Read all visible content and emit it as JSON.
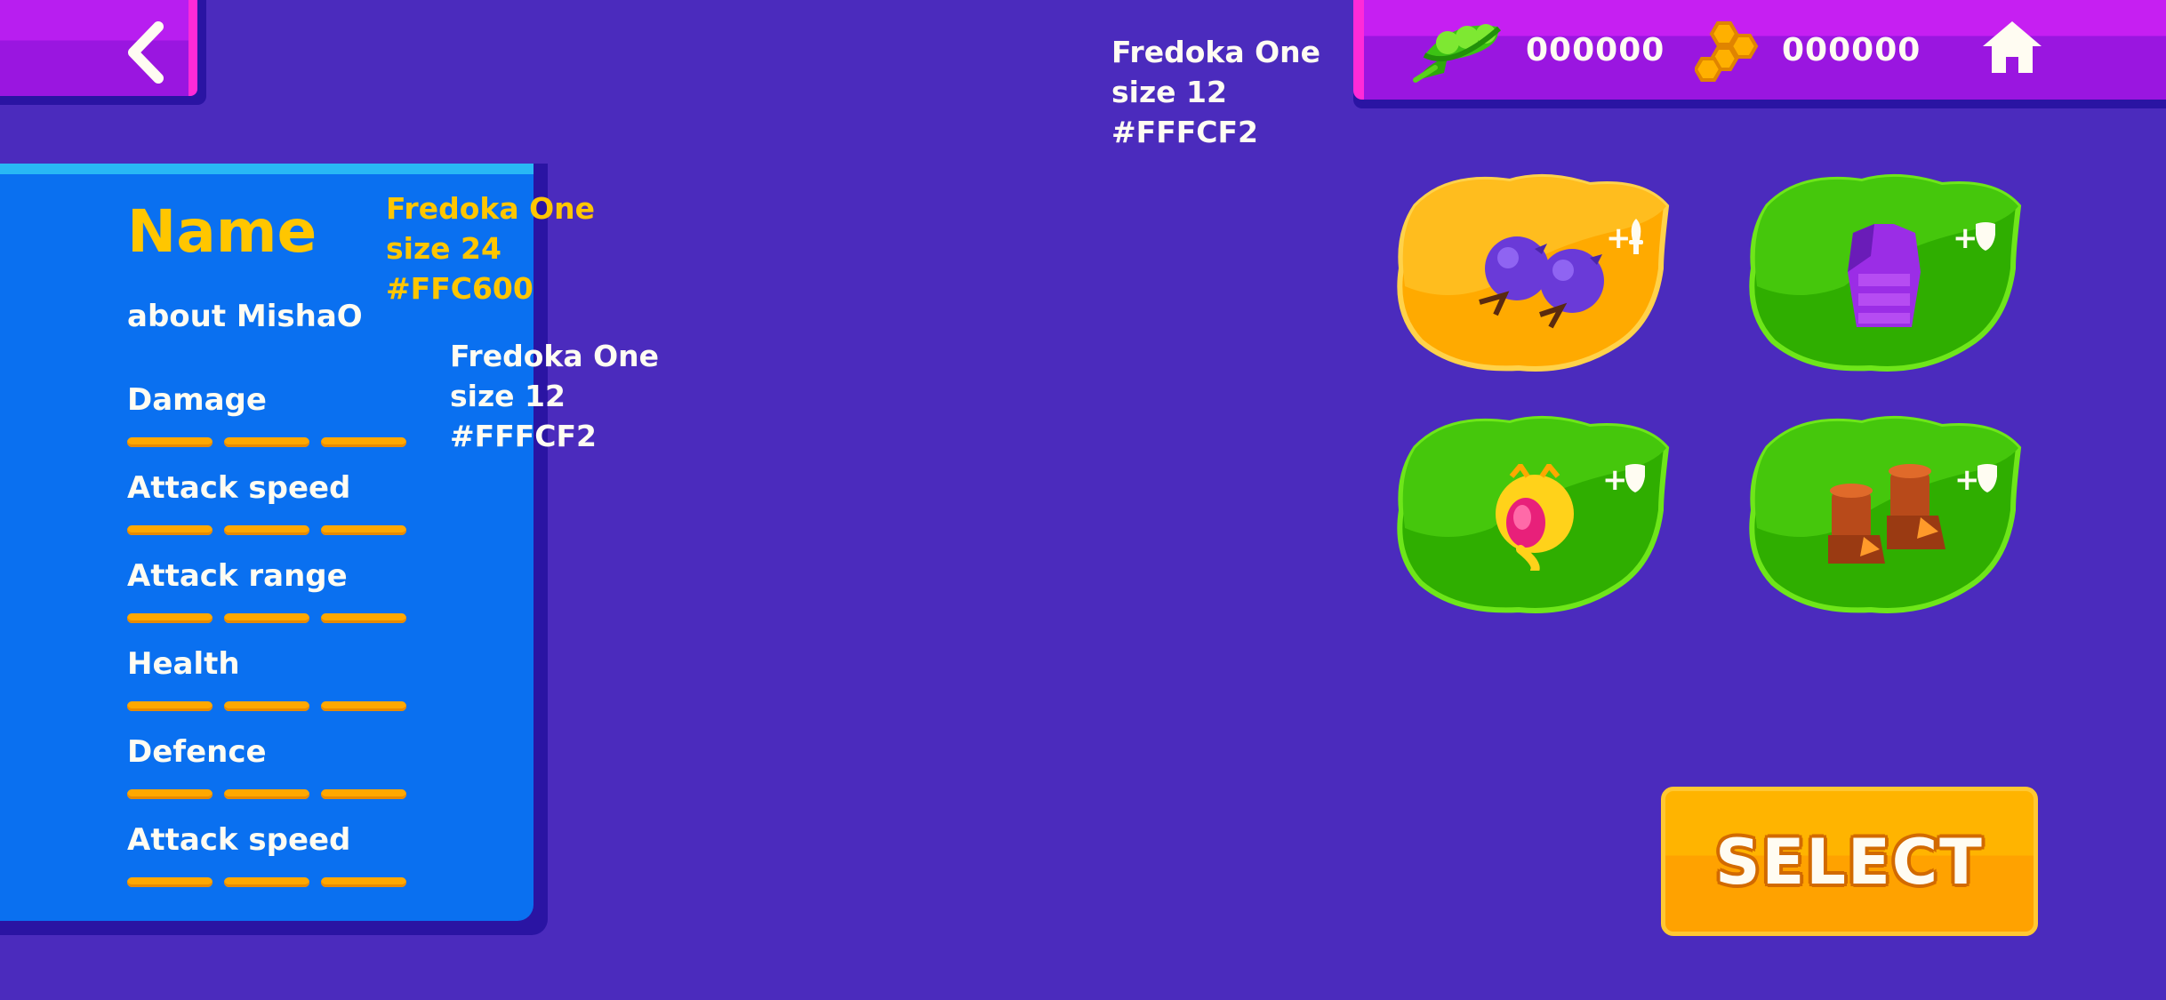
{
  "colors": {
    "background": "#4b2bbd",
    "panel": "#0a70f0",
    "accent_yellow": "#FFC600",
    "text_white": "#FFFCF2",
    "leaf_green": "#3fbf00",
    "leaf_orange": "#ffaa00",
    "button_orange": "#ffa200"
  },
  "header": {
    "back_icon": "chevron-left-icon",
    "peas_count": "000000",
    "honey_count": "000000",
    "home_icon": "home-icon"
  },
  "notes": {
    "top": "Fredoka One\nsize 12\n#FFFCF2",
    "name_spec": "Fredoka One\nsize 24\n#FFC600",
    "text_spec": "Fredoka One\nsize 12\n#FFFCF2"
  },
  "panel": {
    "name": "Name",
    "about": "about MishaO",
    "stats": [
      {
        "label": "Damage"
      },
      {
        "label": "Attack speed"
      },
      {
        "label": "Attack range"
      },
      {
        "label": "Health"
      },
      {
        "label": "Defence"
      },
      {
        "label": "Attack speed"
      }
    ]
  },
  "items": [
    {
      "name": "blueberry-gloves",
      "badge": "+",
      "badge_icon": "sword-icon",
      "selected": true
    },
    {
      "name": "purple-armor",
      "badge": "+",
      "badge_icon": "shield-icon",
      "selected": false
    },
    {
      "name": "golden-helmet",
      "badge": "+",
      "badge_icon": "shield-icon",
      "selected": false
    },
    {
      "name": "brown-boots",
      "badge": "+",
      "badge_icon": "shield-icon",
      "selected": false
    }
  ],
  "select_button": {
    "label": "SELECT"
  }
}
